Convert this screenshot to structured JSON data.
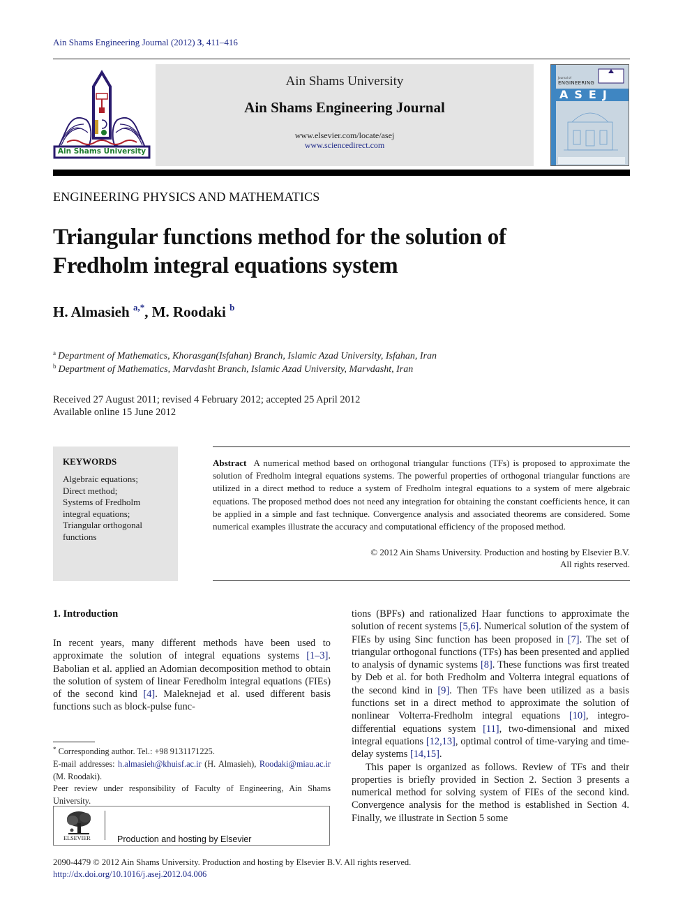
{
  "running_head": {
    "journal": "Ain Shams Engineering Journal (2012)",
    "volume": "3",
    "pages": ", 411–416"
  },
  "masthead": {
    "logo_text": "Ain Shams University",
    "university": "Ain Shams University",
    "journal": "Ain Shams Engineering Journal",
    "url_locate": "www.elsevier.com/locate/asej",
    "url_sciencedirect": "www.sciencedirect.com",
    "cover": {
      "small_label": "Journal of",
      "word": "ENGINEERING",
      "acronym": "ASEJ"
    }
  },
  "section_label": "ENGINEERING PHYSICS AND MATHEMATICS",
  "title_lines": [
    "Triangular functions method for the solution of",
    "Fredholm integral equations system"
  ],
  "authors": [
    {
      "name": "H. Almasieh",
      "sup": "a,*"
    },
    {
      "name": "M. Roodaki",
      "sup": "b"
    }
  ],
  "author_separator": ", ",
  "affiliations": [
    {
      "mark": "a",
      "text": "Department of Mathematics, Khorasgan(Isfahan) Branch, Islamic Azad University, Isfahan, Iran"
    },
    {
      "mark": "b",
      "text": "Department of Mathematics, Marvdasht Branch, Islamic Azad University, Marvdasht, Iran"
    }
  ],
  "dates": {
    "history": "Received 27 August 2011; revised 4 February 2012; accepted 25 April 2012",
    "online": "Available online 15 June 2012"
  },
  "keywords": {
    "heading": "KEYWORDS",
    "items": [
      "Algebraic equations;",
      "Direct method;",
      "Systems of Fredholm",
      "integral equations;",
      "Triangular orthogonal",
      "functions"
    ]
  },
  "abstract": {
    "label": "Abstract",
    "text": "A numerical method based on orthogonal triangular functions (TFs) is proposed to approximate the solution of Fredholm integral equations systems. The powerful properties of orthogonal triangular functions are utilized in a direct method to reduce a system of Fredholm integral equations to a system of mere algebraic equations. The proposed method does not need any integration for obtaining the constant coefficients hence, it can be applied in a simple and fast technique. Convergence analysis and associated theorems are considered. Some numerical examples illustrate the accuracy and computational efficiency of the proposed method.",
    "copyright_line1": "© 2012 Ain Shams University. Production and hosting by Elsevier B.V.",
    "copyright_line2": "All rights reserved."
  },
  "introduction": {
    "heading": "1. Introduction",
    "left_col": [
      {
        "t": "In recent years, many different methods have been used to approximate the solution of integral equations systems "
      },
      {
        "ref": "[1–3]"
      },
      {
        "t": ". Babolian et al. applied an Adomian decomposition method to obtain the solution of system of linear Feredholm integral equations (FIEs) of the second kind "
      },
      {
        "ref": "[4]"
      },
      {
        "t": ". Maleknejad et al. used different basis functions such as block-pulse func-"
      }
    ],
    "right_col_p1": [
      {
        "t": "tions (BPFs) and rationalized Haar functions to approximate the solution of recent systems "
      },
      {
        "ref": "[5,6]"
      },
      {
        "t": ". Numerical solution of the system of FIEs by using Sinc function has been proposed in "
      },
      {
        "ref": "[7]"
      },
      {
        "t": ". The set of triangular orthogonal functions (TFs) has been presented and applied to analysis of dynamic systems "
      },
      {
        "ref": "[8]"
      },
      {
        "t": ". These functions was first treated by Deb et al. for both Fredholm and Volterra integral equations of the second kind in "
      },
      {
        "ref": "[9]"
      },
      {
        "t": ". Then TFs have been utilized as a basis functions set in a direct method to approximate the solution of nonlinear Volterra-Fredholm integral equations "
      },
      {
        "ref": "[10]"
      },
      {
        "t": ", integro-differential equations system "
      },
      {
        "ref": "[11]"
      },
      {
        "t": ", two-dimensional and mixed integral equations "
      },
      {
        "ref": "[12,13]"
      },
      {
        "t": ", optimal control of time-varying and time-delay systems "
      },
      {
        "ref": "[14,15]"
      },
      {
        "t": "."
      }
    ],
    "right_col_p2": "This paper is organized as follows. Review of TFs and their properties is briefly provided in Section 2. Section 3 presents a numerical method for solving system of FIEs of the second kind. Convergence analysis for the method is established in Section 4. Finally, we illustrate in Section 5 some"
  },
  "footnotes": {
    "corresponding_mark": "*",
    "corresponding": "Corresponding author. Tel.: +98 9131171225.",
    "email_label": "E-mail addresses: ",
    "email1": "h.almasieh@khuisf.ac.ir",
    "email1_owner": " (H. Almasieh), ",
    "email2": "Roodaki@miau.ac.ir",
    "email2_owner": " (M. Roodaki).",
    "peer_review": "Peer review under responsibility of Faculty of Engineering, Ain Shams University."
  },
  "elsevier_box": {
    "wordmark": "ELSEVIER",
    "text": "Production and hosting by Elsevier"
  },
  "bottom": {
    "issn_line": "2090-4479 © 2012 Ain Shams University. Production and hosting by Elsevier B.V. All rights reserved.",
    "doi": "http://dx.doi.org/10.1016/j.asej.2012.04.006"
  },
  "colors": {
    "link": "#1f2b8a",
    "masthead_bg": "#e4e4e4",
    "keywords_bg": "#e4e4e4",
    "cover_blue": "#3f86c2",
    "logo_purple": "#2a1b6e",
    "logo_green": "#1c7a2c",
    "logo_red": "#b0202a"
  }
}
